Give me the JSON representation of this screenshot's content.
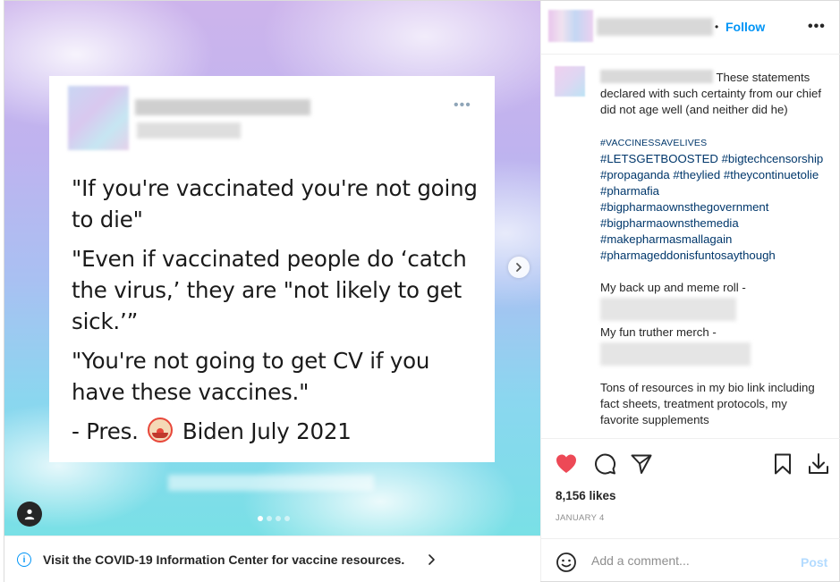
{
  "media": {
    "tweet": {
      "more_glyph": "•••",
      "quotes": [
        "\"If you're vaccinated you're not going to die\"",
        "\"Even if vaccinated people do ‘catch the virus,’ they are \"not likely to get sick.’”",
        "\"You're not going to get CV if you have these vaccines.\""
      ],
      "signature_before": "- Pres.",
      "signature_after": "Biden July 2021"
    },
    "carousel_dots": 4,
    "carousel_active": 0
  },
  "covid_banner": {
    "info_glyph": "i",
    "text": "Visit the COVID-19 Information Center for vaccine resources."
  },
  "header": {
    "separator": "•",
    "follow_label": "Follow",
    "more_glyph": "•••"
  },
  "caption": {
    "text": "These statements declared with such certainty from our chief did not age well (and neither did he)",
    "hashtags": [
      "#VACCINESSAVELIVES",
      "#LETSGETBOOSTED",
      "#bigtechcensorship",
      "#propaganda",
      "#theylied",
      "#theycontinuetolie",
      "#pharmafia",
      "#bigpharmaownsthegovernment",
      "#bigpharmaownsthemedia",
      "#makepharmasmallagain",
      "#pharmageddonisfuntosaythough"
    ],
    "backup_line": "My back up and meme roll -",
    "merch_line": "My fun truther merch -",
    "resources_line": "Tons of resources in my bio link including fact sheets, treatment protocols, my favorite supplements"
  },
  "actions": {
    "likes": "8,156 likes",
    "date": "JANUARY 4"
  },
  "comment": {
    "placeholder": "Add a comment...",
    "post_label": "Post"
  },
  "colors": {
    "accent": "#0095f6",
    "heart": "#ed4956",
    "hashtag": "#00376b",
    "post_disabled": "#b3dbff"
  }
}
